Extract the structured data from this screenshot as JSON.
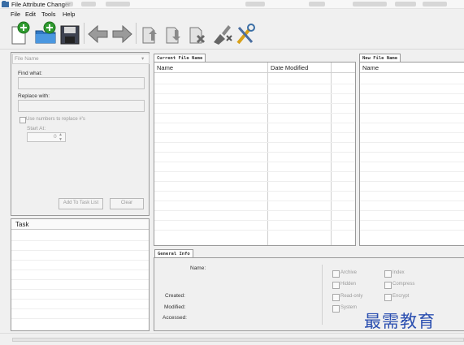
{
  "window": {
    "title": "File Attribute Changer"
  },
  "menu": [
    "File",
    "Edit",
    "Tools",
    "Help"
  ],
  "toolbar": [
    {
      "icon": "add-file-icon"
    },
    {
      "icon": "add-folder-icon"
    },
    {
      "icon": "save-icon"
    },
    {
      "icon": "back-arrow-icon"
    },
    {
      "icon": "forward-arrow-icon"
    },
    {
      "icon": "move-up-icon"
    },
    {
      "icon": "move-down-icon"
    },
    {
      "icon": "remove-file-icon"
    },
    {
      "icon": "clear-icon"
    },
    {
      "icon": "tools-icon"
    }
  ],
  "left_panel": {
    "mode_select": "File Name",
    "find_label": "Find what:",
    "replace_label": "Replace with:",
    "use_numbers_label": "Use numbers to replace #'s",
    "start_at_label": "Start At:",
    "start_at_value": "0",
    "add_button": "Add To Task List",
    "clear_button": "Clear"
  },
  "task_panel": {
    "header": "Task"
  },
  "current_panel": {
    "tab": "Current File Name",
    "columns": [
      "Name",
      "Date Modified"
    ]
  },
  "new_panel": {
    "tab": "New File Name",
    "columns": [
      "Name"
    ]
  },
  "info_panel": {
    "tab": "General Info",
    "labels": {
      "name": "Name:",
      "created": "Created:",
      "modified": "Modified:",
      "accessed": "Accessed:"
    },
    "attributes": [
      "Archive",
      "Index",
      "Hidden",
      "Compress",
      "Read-only",
      "Encrypt",
      "System"
    ]
  },
  "watermark": "最需教育",
  "colors": {
    "accent_green": "#2e9a2e",
    "watermark_blue": "#2b4fb0"
  }
}
